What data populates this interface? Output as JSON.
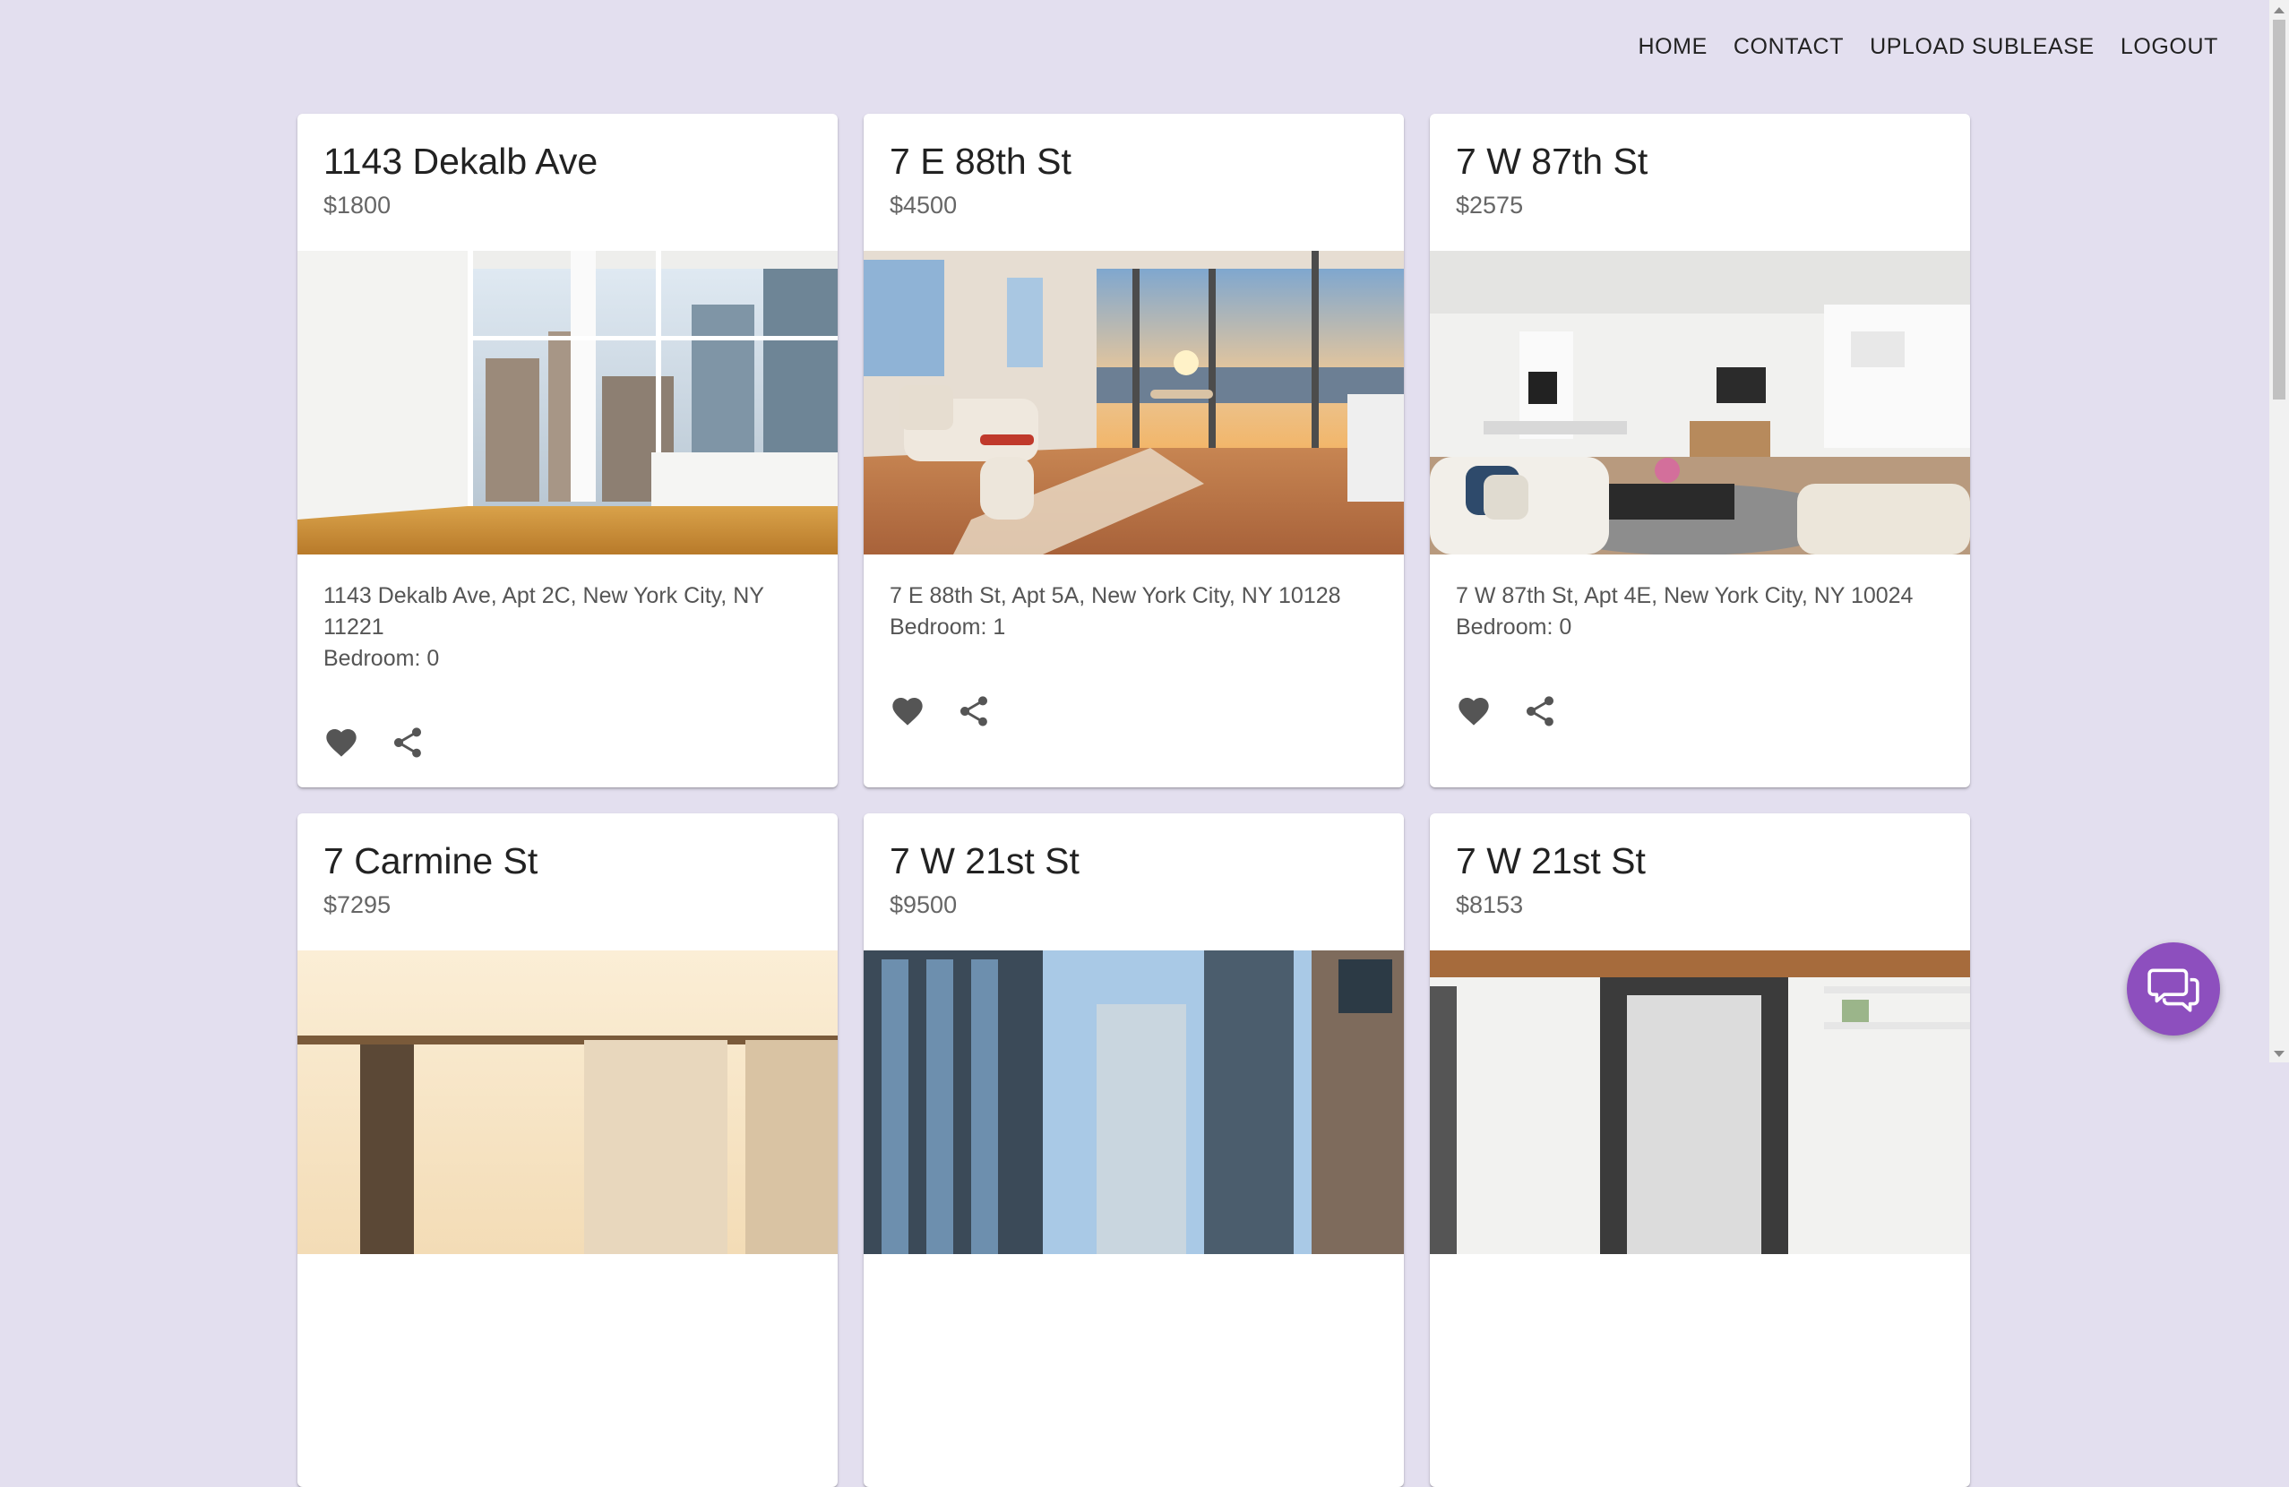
{
  "nav": {
    "items": [
      "HOME",
      "CONTACT",
      "UPLOAD SUBLEASE",
      "LOGOUT"
    ]
  },
  "listings": [
    {
      "title": "1143 Dekalb Ave",
      "price": "$1800",
      "address": "1143 Dekalb Ave, Apt 2C, New York City, NY 11221",
      "bedroom": "Bedroom: 0"
    },
    {
      "title": "7 E 88th St",
      "price": "$4500",
      "address": "7 E 88th St, Apt 5A, New York City, NY 10128",
      "bedroom": "Bedroom: 1"
    },
    {
      "title": "7 W 87th St",
      "price": "$2575",
      "address": "7 W 87th St, Apt 4E, New York City, NY 10024",
      "bedroom": "Bedroom: 0"
    },
    {
      "title": "7 Carmine St",
      "price": "$7295"
    },
    {
      "title": "7 W 21st St",
      "price": "$9500"
    },
    {
      "title": "7 W 21st St",
      "price": "$8153"
    }
  ],
  "icons": {
    "favorite": "heart-icon",
    "share": "share-icon",
    "chat": "chat-icon"
  },
  "colors": {
    "background": "#e3dfef",
    "chat_button": "#8d4fbe",
    "icon": "#555555"
  }
}
